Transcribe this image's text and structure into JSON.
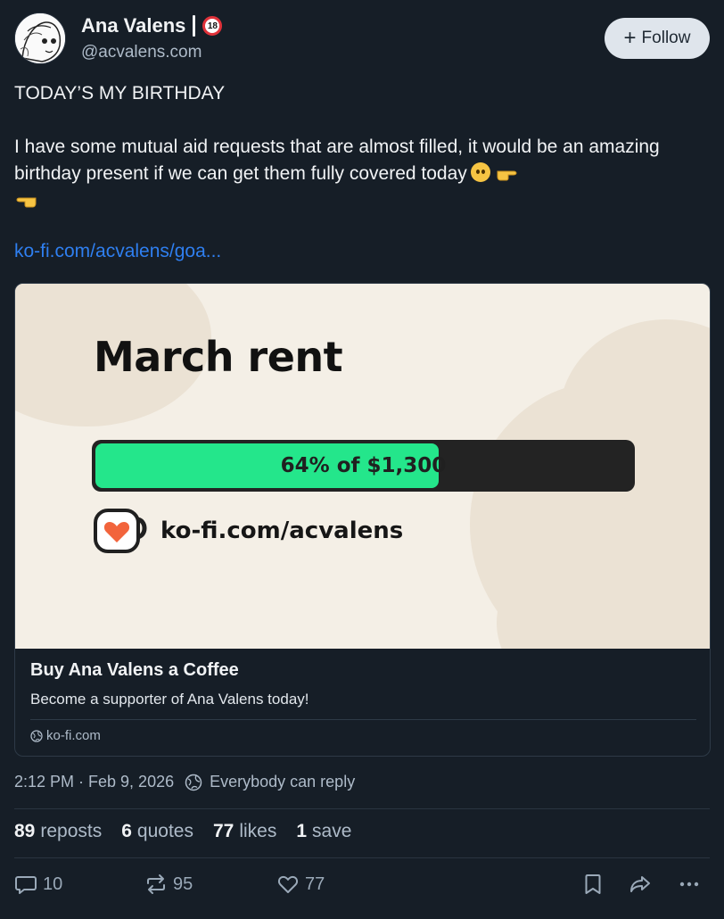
{
  "author": {
    "name": "Ana Valens",
    "badge": "18",
    "handle": "@acvalens.com"
  },
  "follow_button": {
    "label": "Follow"
  },
  "post": {
    "line1": "TODAY’S MY BIRTHDAY",
    "line2": "I have some mutual aid requests that are almost filled, it would be an amazing birthday present if we can get them fully covered today",
    "link_text": "ko-fi.com/acvalens/goa..."
  },
  "card": {
    "image_title": "March rent",
    "progress_label": "64% of $1,300",
    "progress_fraction": 0.64,
    "image_url": "ko-fi.com/acvalens",
    "heading": "Buy Ana Valens a Coffee",
    "description": "Become a supporter of Ana Valens today!",
    "domain": "ko-fi.com"
  },
  "meta": {
    "timestamp": "2:12 PM · Feb 9, 2026",
    "reply_setting": "Everybody can reply"
  },
  "stats": [
    {
      "count": "89",
      "label": "reposts"
    },
    {
      "count": "6",
      "label": "quotes"
    },
    {
      "count": "77",
      "label": "likes"
    },
    {
      "count": "1",
      "label": "save"
    }
  ],
  "actions": {
    "reply_count": "10",
    "repost_count": "95",
    "like_count": "77"
  },
  "colors": {
    "background": "#161e27",
    "link": "#2f7ff0",
    "progress_fill": "#24e68b",
    "card_image_bg": "#f4efe6"
  }
}
